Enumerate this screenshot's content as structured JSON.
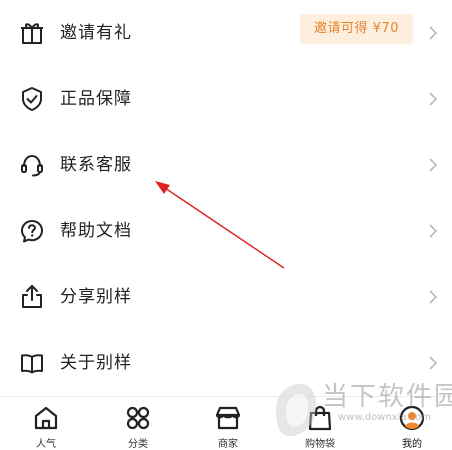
{
  "menu": {
    "items": [
      {
        "label": "邀请有礼",
        "icon": "gift-icon",
        "badge": "邀请可得 ¥70"
      },
      {
        "label": "正品保障",
        "icon": "shield-check-icon"
      },
      {
        "label": "联系客服",
        "icon": "headset-icon"
      },
      {
        "label": "帮助文档",
        "icon": "help-doc-icon"
      },
      {
        "label": "分享别样",
        "icon": "share-icon"
      },
      {
        "label": "关于别样",
        "icon": "book-icon"
      }
    ]
  },
  "tabbar": {
    "tabs": [
      {
        "label": "人气",
        "icon": "home-icon"
      },
      {
        "label": "分类",
        "icon": "category-icon"
      },
      {
        "label": "商家",
        "icon": "store-icon"
      },
      {
        "label": "购物袋",
        "icon": "shopping-bag-icon"
      },
      {
        "label": "我的",
        "icon": "profile-icon",
        "active": true
      }
    ]
  },
  "watermark": {
    "text": "当下软件园",
    "url": "www.downxia.com"
  },
  "colors": {
    "badge_bg": "#fdeede",
    "badge_text": "#e48530",
    "arrow": "#e02020",
    "profile_accent": "#f0892e"
  }
}
